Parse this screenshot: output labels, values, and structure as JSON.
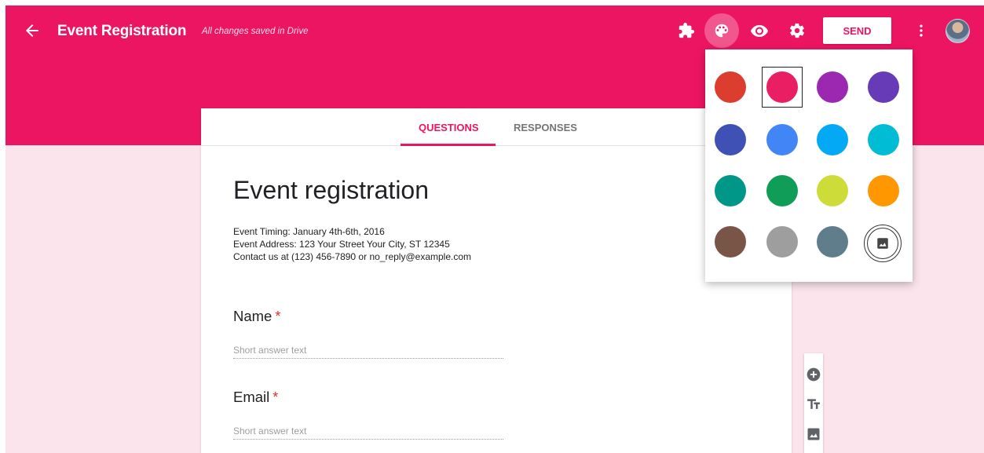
{
  "header": {
    "title": "Event Registration",
    "saved_status": "All changes saved in Drive",
    "send_label": "SEND"
  },
  "tabs": {
    "questions": "QUESTIONS",
    "responses": "RESPONSES"
  },
  "form": {
    "title": "Event registration",
    "description": [
      "Event Timing: January 4th-6th, 2016",
      "Event Address: 123 Your Street Your City, ST 12345",
      "Contact us at (123) 456-7890 or no_reply@example.com"
    ],
    "questions": [
      {
        "title": "Name",
        "required_mark": "*",
        "placeholder": "Short answer text"
      },
      {
        "title": "Email",
        "required_mark": "*",
        "placeholder": "Short answer text"
      }
    ]
  },
  "theme": {
    "header_color": "#ec1561",
    "selected_color": "#e91e63",
    "colors": [
      "#db3e2e",
      "#e91e63",
      "#9c27b0",
      "#673ab7",
      "#3f51b5",
      "#4285f4",
      "#03a9f4",
      "#00bcd4",
      "#009688",
      "#0f9d58",
      "#cddc39",
      "#ff9800",
      "#795548",
      "#9e9e9e",
      "#607d8b"
    ]
  },
  "icons": [
    "back-arrow-icon",
    "puzzle-icon",
    "palette-icon",
    "eye-icon",
    "gear-icon",
    "more-vert-icon",
    "add-circle-icon",
    "text-icon",
    "image-icon"
  ]
}
